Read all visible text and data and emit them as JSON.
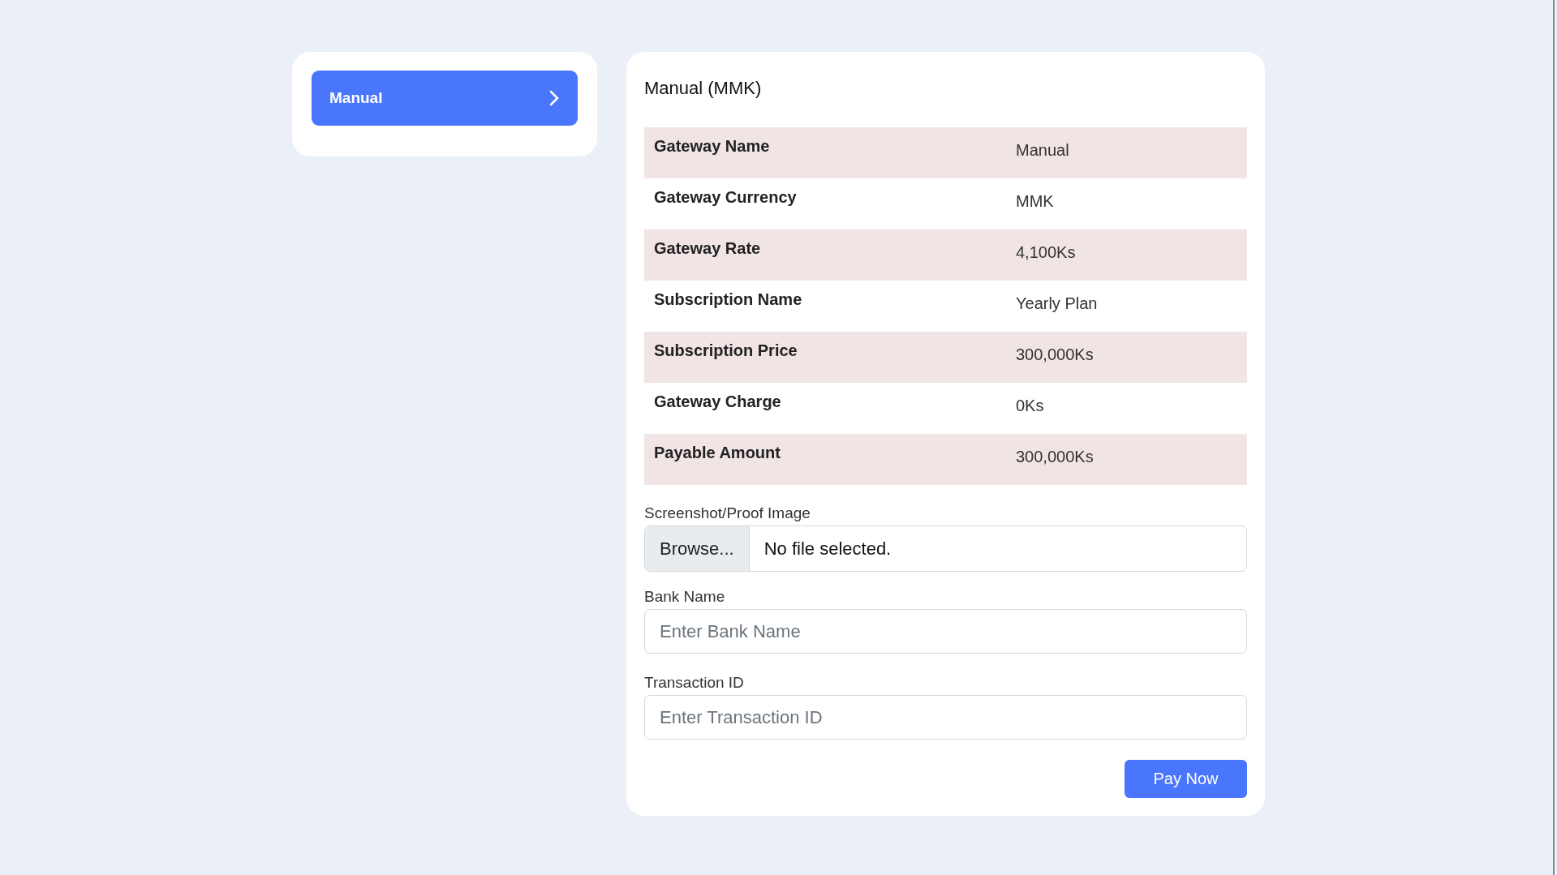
{
  "gateways": [
    {
      "label": "Manual",
      "selected": true
    }
  ],
  "details": {
    "title": "Manual (MMK)",
    "rows": [
      {
        "label": "Gateway Name",
        "value": "Manual"
      },
      {
        "label": "Gateway Currency",
        "value": "MMK"
      },
      {
        "label": "Gateway Rate",
        "value": "4,100Ks"
      },
      {
        "label": "Subscription Name",
        "value": "Yearly Plan"
      },
      {
        "label": "Subscription Price",
        "value": "300,000Ks"
      },
      {
        "label": "Gateway Charge",
        "value": "0Ks"
      },
      {
        "label": "Payable Amount",
        "value": "300,000Ks"
      }
    ]
  },
  "form": {
    "proof": {
      "label": "Screenshot/Proof Image",
      "button": "Browse...",
      "status": "No file selected."
    },
    "fields": [
      {
        "label": "Bank Name",
        "placeholder": "Enter Bank Name"
      },
      {
        "label": "Transaction ID",
        "placeholder": "Enter Transaction ID"
      }
    ],
    "submit": "Pay Now"
  }
}
